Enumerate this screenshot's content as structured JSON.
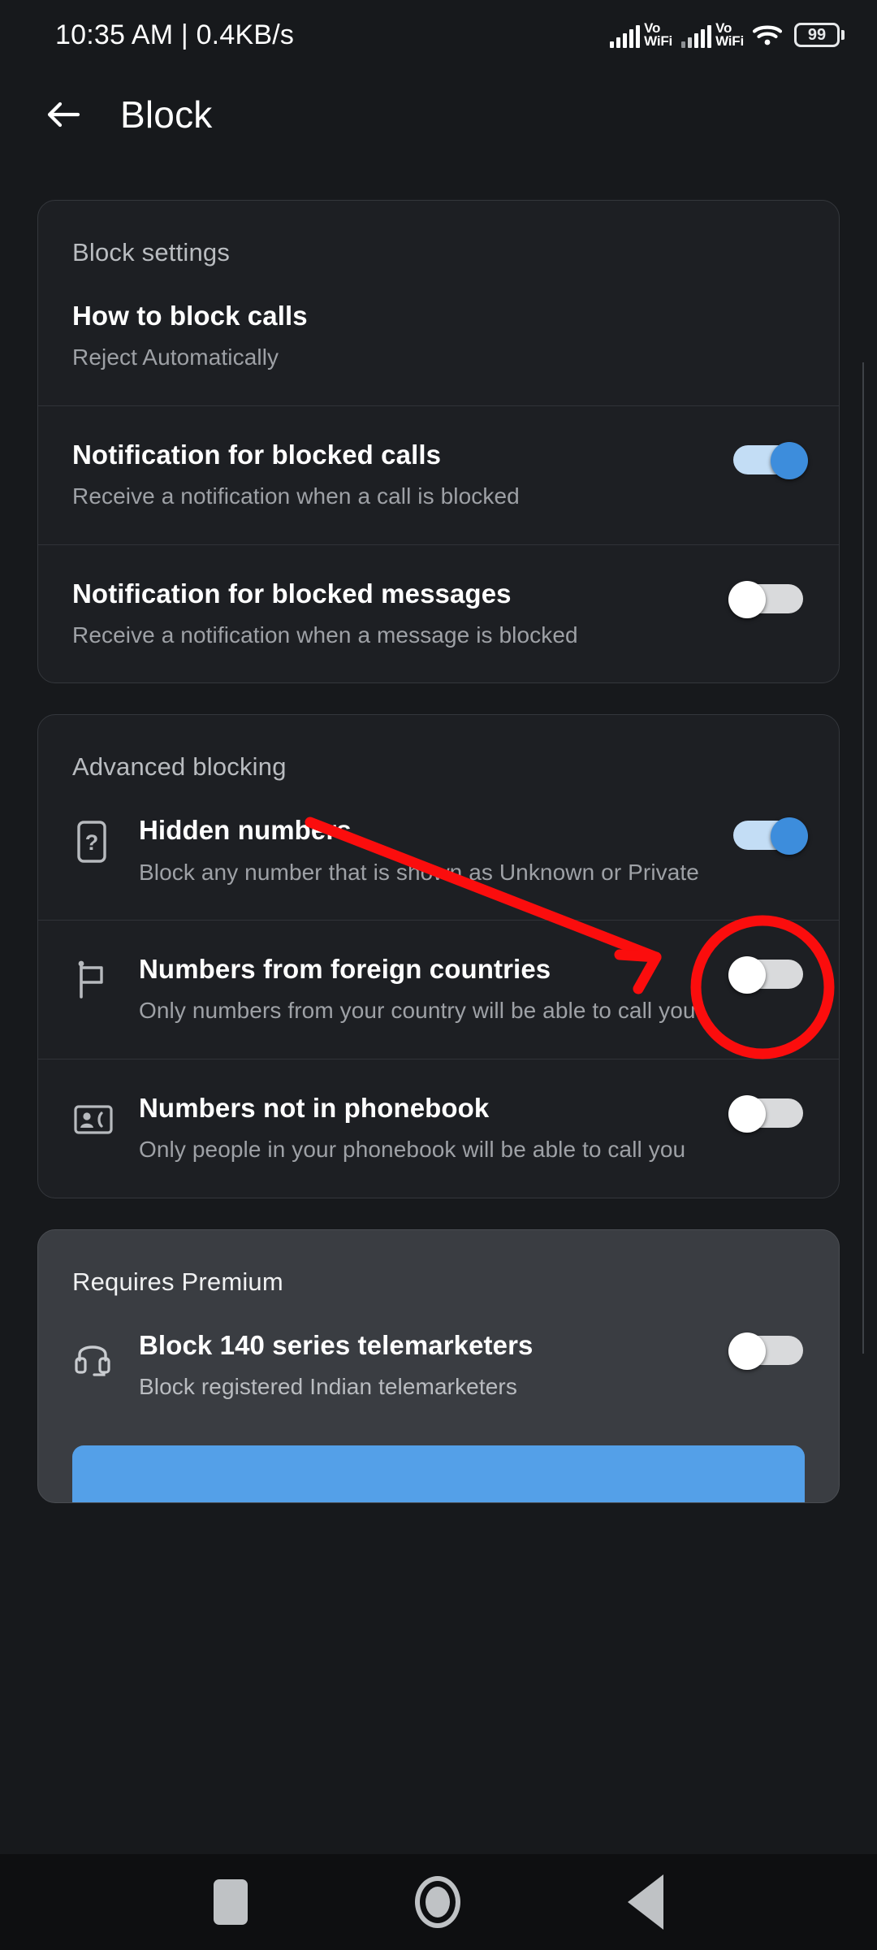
{
  "statusbar": {
    "time_and_speed": "10:35 AM | 0.4KB/s",
    "sim1_label": "Vo\nWiFi",
    "sim1_line1": "Vo",
    "sim1_line2": "WiFi",
    "sim2_line1": "Vo",
    "sim2_line2": "WiFi",
    "wifi_icon": "wifi-icon",
    "battery_level": "99"
  },
  "appbar": {
    "back_icon": "back-arrow-icon",
    "title": "Block"
  },
  "cards": [
    {
      "id": "block-settings",
      "title": "Block settings",
      "rows": [
        {
          "id": "how-to-block-calls",
          "title": "How to block calls",
          "subtitle": "Reject Automatically",
          "icon": null,
          "toggle": null
        },
        {
          "id": "notification-blocked-calls",
          "title": "Notification for blocked calls",
          "subtitle": "Receive a notification when a call is blocked",
          "icon": null,
          "toggle": "on"
        },
        {
          "id": "notification-blocked-messages",
          "title": "Notification for blocked messages",
          "subtitle": "Receive a notification when a message is blocked",
          "icon": null,
          "toggle": "off"
        }
      ]
    },
    {
      "id": "advanced-blocking",
      "title": "Advanced blocking",
      "rows": [
        {
          "id": "hidden-numbers",
          "title": "Hidden numbers",
          "subtitle": "Block any number that is shown as Unknown or Private",
          "icon": "phone-question-icon",
          "toggle": "on"
        },
        {
          "id": "foreign-countries",
          "title": "Numbers from foreign countries",
          "subtitle": "Only numbers from your country will be able to call you",
          "icon": "flag-icon",
          "toggle": "off"
        },
        {
          "id": "not-in-phonebook",
          "title": "Numbers not in phonebook",
          "subtitle": "Only people in your phonebook will be able to call you",
          "icon": "contact-card-phone-icon",
          "toggle": "off"
        }
      ]
    },
    {
      "id": "requires-premium",
      "title": "Requires Premium",
      "rows": [
        {
          "id": "block-140-series",
          "title": "Block 140 series telemarketers",
          "subtitle": "Block registered Indian telemarketers",
          "icon": "headset-icon",
          "toggle": "off"
        }
      ]
    }
  ],
  "navbar": {
    "recents_icon": "recents-square-icon",
    "home_icon": "home-circle-icon",
    "back_icon": "back-triangle-icon"
  },
  "annotation": {
    "highlight_color": "#fb0d0d",
    "arrow_name": "red-arrow-annotation",
    "circle_name": "red-circle-highlight",
    "target": "hidden-numbers-toggle"
  },
  "colors": {
    "accent_blue": "#3d8ddc",
    "cta_blue": "#54a0e8",
    "page_bg": "#17191c",
    "card_bg": "#1d1f23",
    "premium_card_bg": "#3a3d42",
    "annotation_red": "#fb0d0d"
  }
}
